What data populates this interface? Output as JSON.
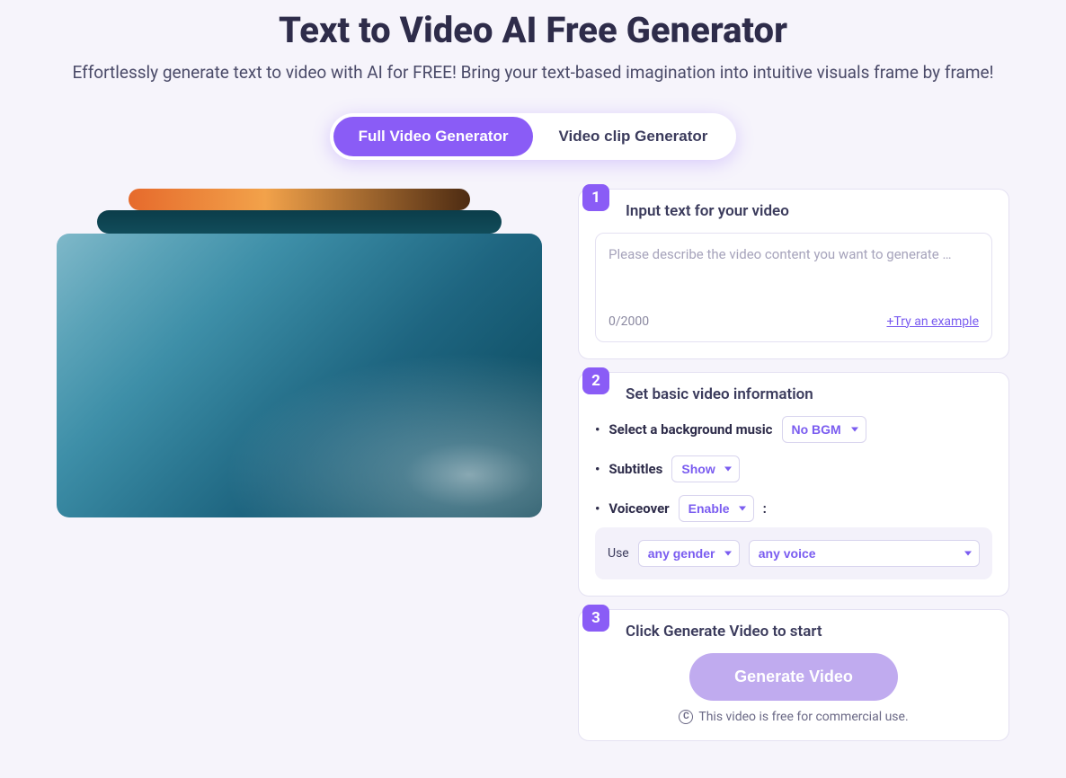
{
  "header": {
    "title": "Text to Video AI Free Generator",
    "subtitle": "Effortlessly generate text to video with AI for FREE! Bring your text-based imagination into intuitive visuals frame by frame!"
  },
  "tabs": {
    "full": "Full Video Generator",
    "clip": "Video clip Generator"
  },
  "steps": {
    "s1": {
      "num": "1",
      "title": "Input text for your video",
      "placeholder": "Please describe the video content you want to generate …",
      "count": "0/2000",
      "example": "+Try an example"
    },
    "s2": {
      "num": "2",
      "title": "Set basic video information",
      "bgm_label": "Select a background music",
      "bgm_value": "No BGM",
      "sub_label": "Subtitles",
      "sub_value": "Show",
      "vo_label": "Voiceover",
      "vo_value": "Enable",
      "use_label": "Use",
      "gender_value": "any gender",
      "voice_value": "any voice"
    },
    "s3": {
      "num": "3",
      "title": "Click Generate Video to start",
      "button": "Generate Video",
      "license": "This video is free for commercial use.",
      "cc": "C"
    }
  }
}
